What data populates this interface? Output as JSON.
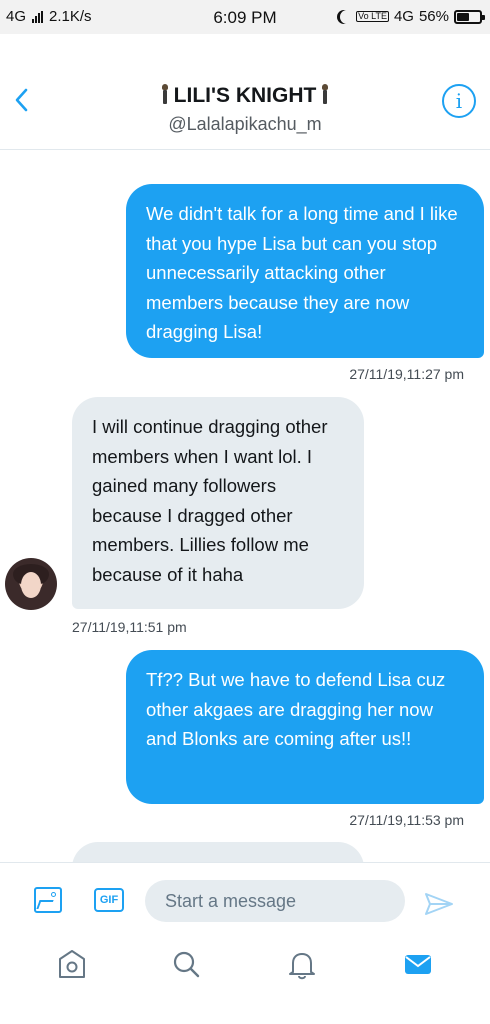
{
  "status_bar": {
    "network_left": "4G",
    "speed": "2.1K/s",
    "time": "6:09 PM",
    "volte": "Vo LTE",
    "network_right": "4G",
    "battery_text": "56%",
    "battery_level": 0.56
  },
  "header": {
    "title": "LILI'S KNIGHT",
    "handle": "@Lalalapikachu_m"
  },
  "messages": [
    {
      "direction": "sent",
      "text": "We didn't talk for a long time and I like that you hype Lisa but can you stop unnecessarily attacking other members because they are now dragging Lisa!",
      "timestamp": "27/11/19,11:27 pm"
    },
    {
      "direction": "received",
      "text": "I will continue dragging other members when I want lol. I gained many followers because I dragged other members. Lillies follow me because of it haha",
      "timestamp": "27/11/19,11:51 pm"
    },
    {
      "direction": "sent",
      "text": "Tf?? But we have to defend Lisa cuz other akgaes are dragging her now and Blonks are coming after us!!",
      "timestamp": "27/11/19,11:53 pm"
    }
  ],
  "composer": {
    "gif_label": "GIF",
    "placeholder": "Start a message"
  },
  "icons": {
    "back": "chevron-left-icon",
    "info": "info-icon",
    "image": "image-icon",
    "gif": "gif-icon",
    "send": "send-icon",
    "home": "home-icon",
    "search": "search-icon",
    "notifications": "bell-icon",
    "messages": "mail-icon"
  },
  "colors": {
    "accent": "#1da1f2",
    "received_bubble": "#e6ecf0",
    "text": "#14171a",
    "muted": "#657786"
  }
}
